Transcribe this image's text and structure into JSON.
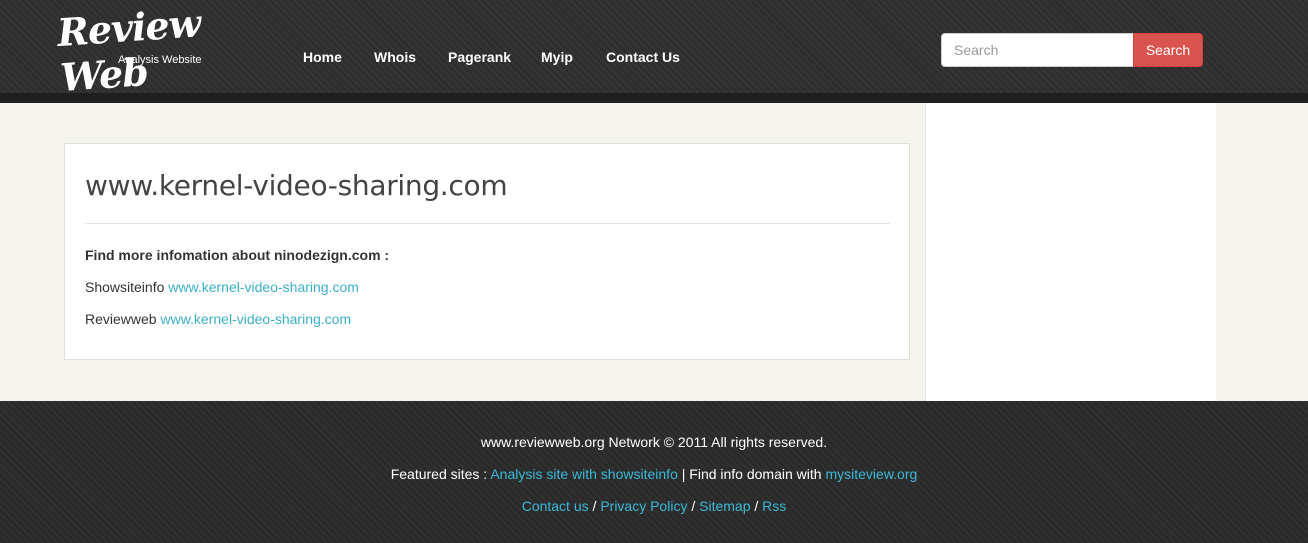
{
  "header": {
    "logo_title": "Review Web",
    "logo_subtitle": "Analysis Website",
    "nav": [
      "Home",
      "Whois",
      "Pagerank",
      "Myip",
      "Contact Us"
    ],
    "search_placeholder": "Search",
    "search_button": "Search"
  },
  "main": {
    "title": "www.kernel-video-sharing.com",
    "info_heading": "Find more infomation about ninodezign.com :",
    "links": [
      {
        "label": "Showsiteinfo",
        "url_text": "www.kernel-video-sharing.com"
      },
      {
        "label": "Reviewweb",
        "url_text": "www.kernel-video-sharing.com"
      }
    ]
  },
  "footer": {
    "copyright": "www.reviewweb.org Network © 2011 All rights reserved.",
    "featured_prefix": "Featured sites :",
    "featured_link": "Analysis site with showsiteinfo",
    "featured_mid": "| Find info domain with",
    "featured_link2": "mysiteview.org",
    "links": [
      "Contact us",
      "Privacy Policy",
      "Sitemap",
      "Rss"
    ],
    "separator": "/"
  },
  "colors": {
    "header_bg": "#2e2e2e",
    "accent_link": "#3ab0c8",
    "search_button": "#d9534f",
    "page_bg": "#f4f3ec"
  }
}
